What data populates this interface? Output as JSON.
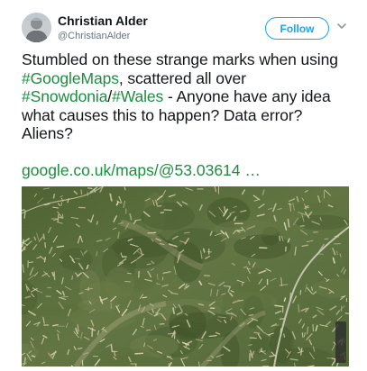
{
  "user": {
    "display_name": "Christian Alder",
    "handle": "@ChristianAlder"
  },
  "actions": {
    "follow_label": "Follow",
    "menu_icon": "chevron-down-icon"
  },
  "tweet": {
    "text_1": "Stumbled on these strange marks when using ",
    "hashtag_1": "#GoogleMaps",
    "text_2": ", scattered all over ",
    "hashtag_2": "#Snowdonia",
    "text_3": "/",
    "hashtag_3": "#Wales",
    "text_4": " - Anyone have any idea what causes this to happen? Data error? Aliens?",
    "link": "google.co.uk/maps/@53.03614 …"
  },
  "colors": {
    "hashtag": "#1b8f3e",
    "follow_accent": "#1da1f2",
    "secondary_text": "#657786"
  }
}
